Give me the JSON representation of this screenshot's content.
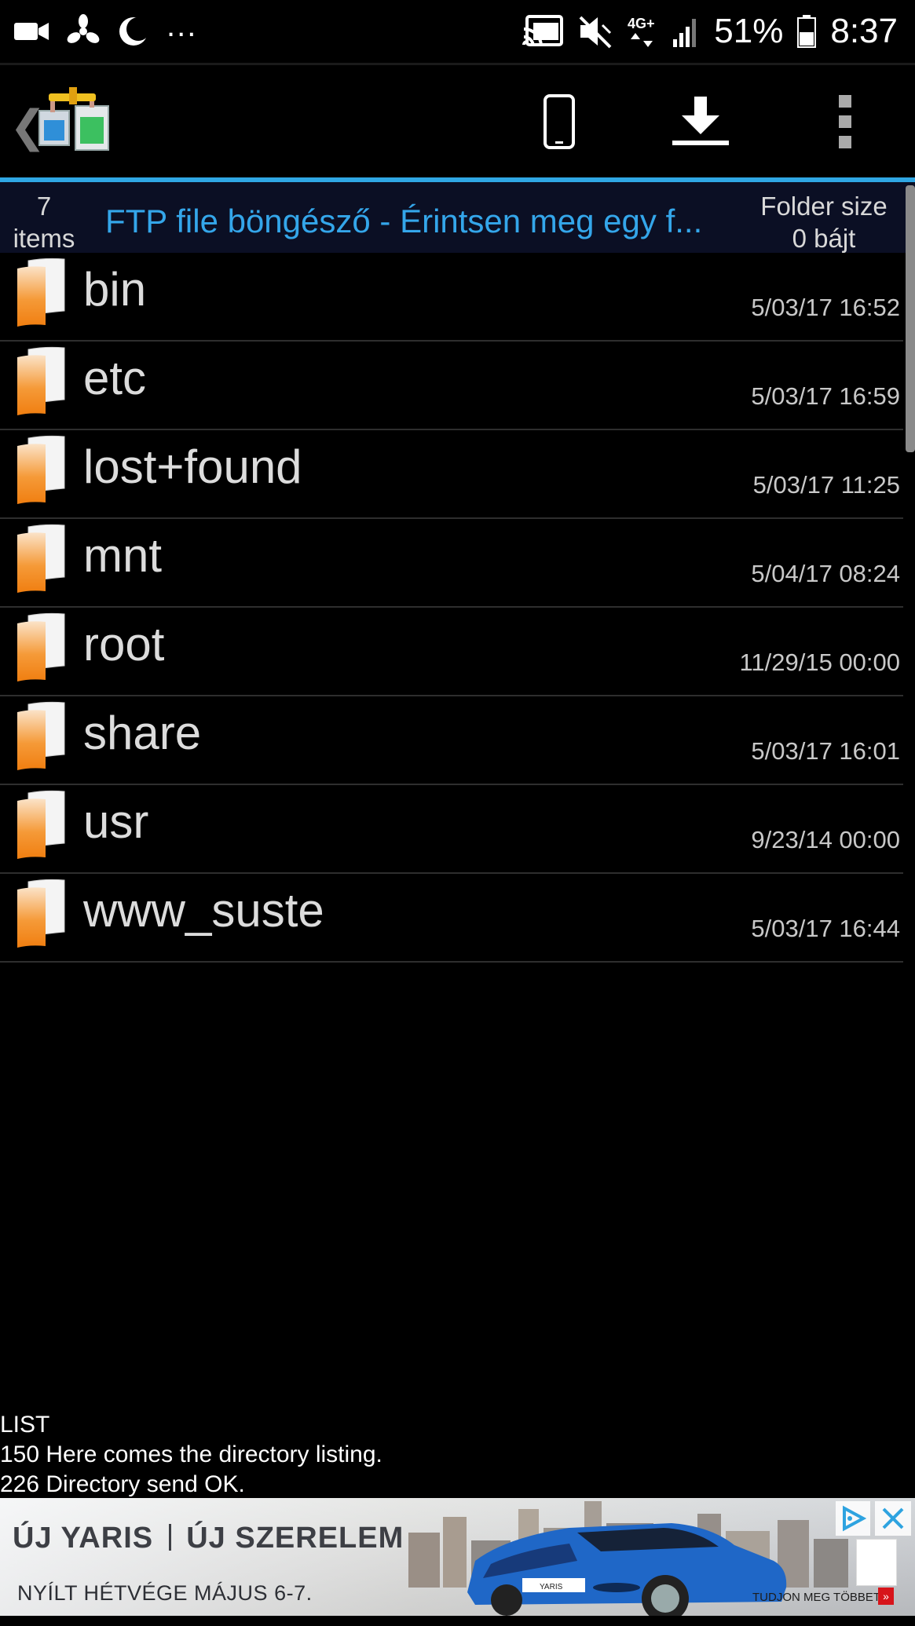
{
  "status_bar": {
    "left_icons": [
      "video-camera-icon",
      "fan-icon",
      "moon-icon"
    ],
    "more": "...",
    "right_icons": [
      "cast-icon",
      "mute-icon",
      "4g-icon",
      "signal-icon"
    ],
    "battery_percent": "51%",
    "battery_icon": "battery-icon",
    "time": "8:37"
  },
  "toolbar": {
    "back": "❮",
    "app_icon": "ftp-app-icon",
    "buttons": [
      "phone-icon",
      "download-icon",
      "more-vert-icon"
    ]
  },
  "header": {
    "count": "7",
    "count_unit": "items",
    "title": "FTP file böngésző - Érintsen meg egy f...",
    "size_label": "Folder size",
    "size_value": "0 bájt",
    "accent": "#34a6ea"
  },
  "files": [
    {
      "name": "bin",
      "date": "5/03/17 16:52"
    },
    {
      "name": "etc",
      "date": "5/03/17 16:59"
    },
    {
      "name": "lost+found",
      "date": "5/03/17 11:25"
    },
    {
      "name": "mnt",
      "date": "5/04/17 08:24"
    },
    {
      "name": "root",
      "date": "11/29/15 00:00"
    },
    {
      "name": "share",
      "date": "5/03/17 16:01"
    },
    {
      "name": "usr",
      "date": "9/23/14 00:00"
    },
    {
      "name": "www_suste",
      "date": "5/03/17 16:44"
    }
  ],
  "log": [
    "LIST",
    "150 Here comes the directory listing.",
    "226 Directory send OK."
  ],
  "ad": {
    "headline_1": "ÚJ YARIS",
    "headline_2": "ÚJ SZERELEM",
    "subline": "NYÍLT HÉTVÉGE MÁJUS 6-7.",
    "cta": "TUDJON MEG TÖBBET",
    "plate": "YARIS",
    "cta_button": "»"
  }
}
